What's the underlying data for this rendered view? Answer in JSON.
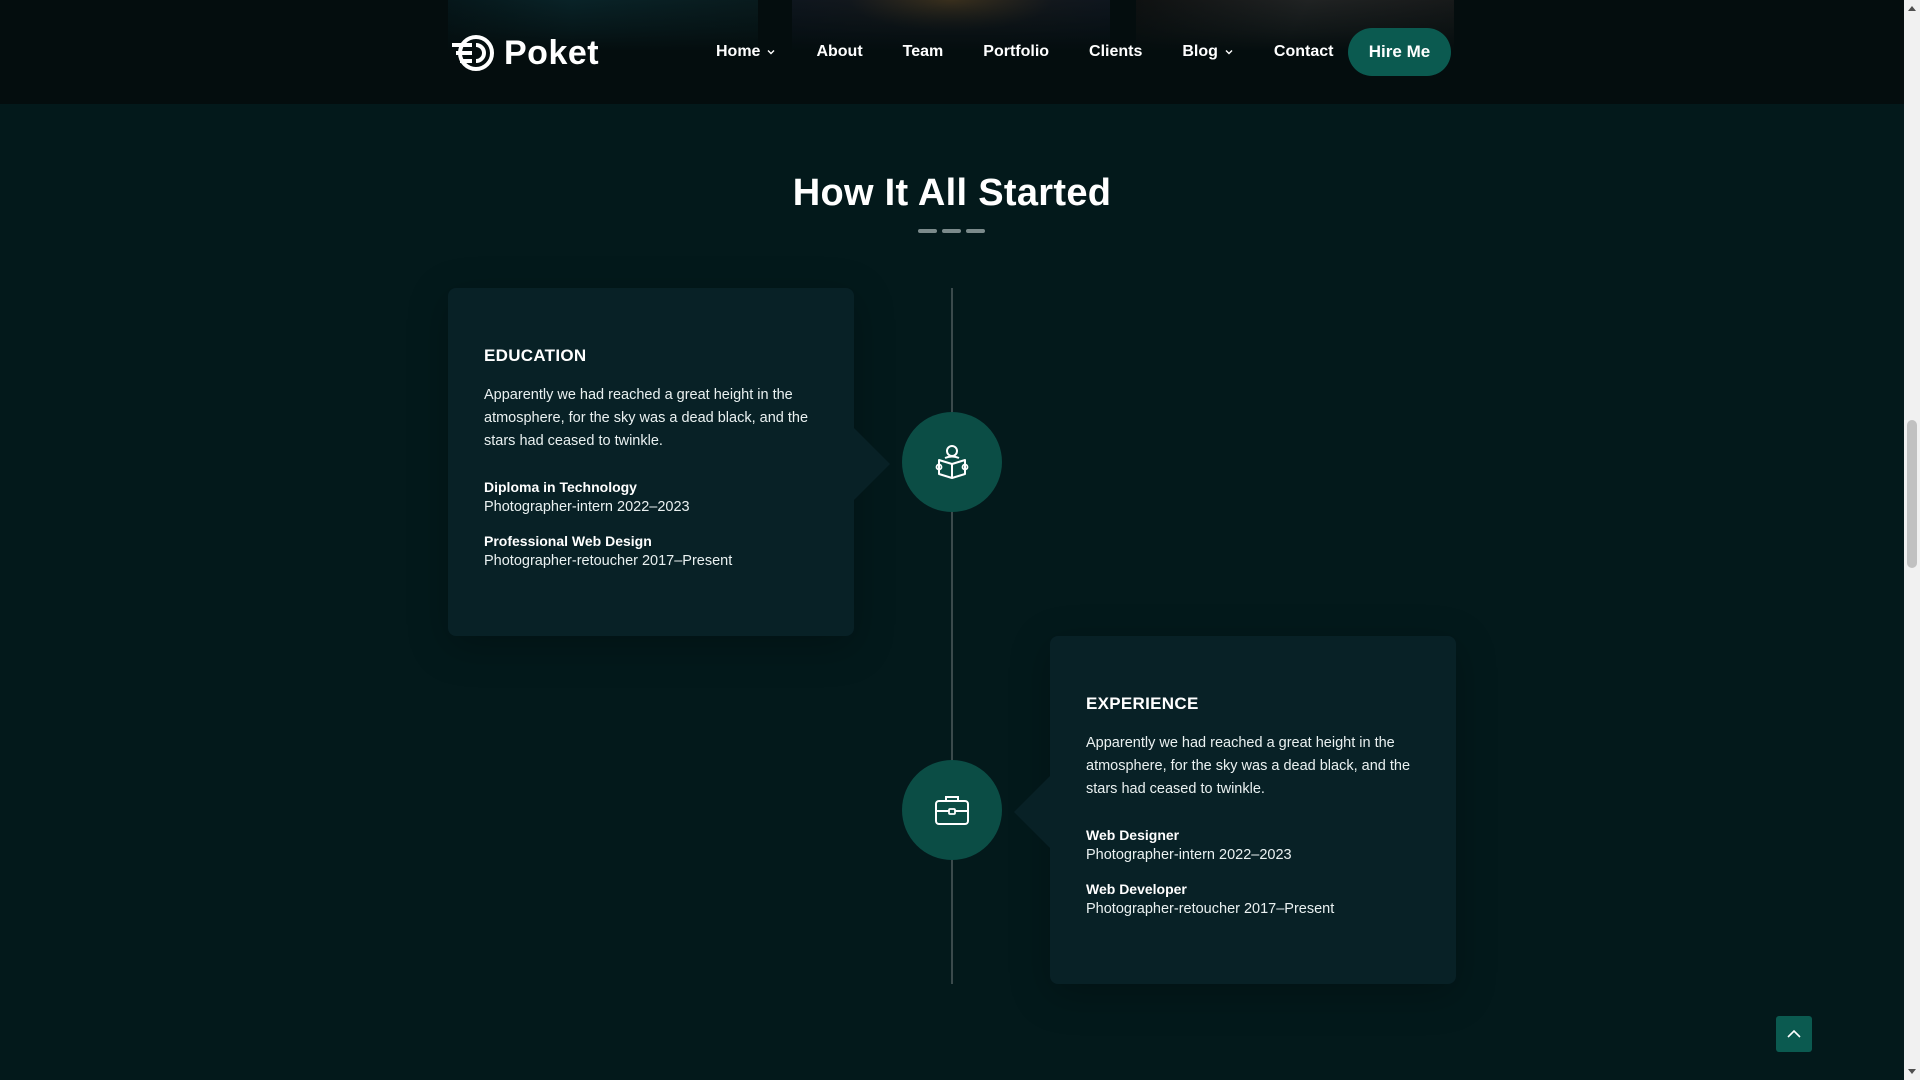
{
  "brand": {
    "name": "Poket",
    "accent": "#0b5a50"
  },
  "nav": {
    "items": [
      {
        "label": "Home",
        "dropdown": true
      },
      {
        "label": "About",
        "dropdown": false
      },
      {
        "label": "Team",
        "dropdown": false
      },
      {
        "label": "Portfolio",
        "dropdown": false
      },
      {
        "label": "Clients",
        "dropdown": false
      },
      {
        "label": "Blog",
        "dropdown": true
      },
      {
        "label": "Contact",
        "dropdown": false
      }
    ],
    "cta_label": "Hire Me"
  },
  "section": {
    "title": "How It All Started"
  },
  "timeline": {
    "education": {
      "title": "EDUCATION",
      "icon": "reading-person-icon",
      "description": "Apparently we had reached a great height in the atmosphere, for the sky was a dead black, and the stars had ceased to twinkle.",
      "entries": [
        {
          "title": "Diploma in Technology",
          "subtitle": "Photographer-intern 2022–2023"
        },
        {
          "title": "Professional Web Design",
          "subtitle": "Photographer-retoucher 2017–Present"
        }
      ]
    },
    "experience": {
      "title": "EXPERIENCE",
      "icon": "briefcase-icon",
      "description": "Apparently we had reached a great height in the atmosphere, for the sky was a dead black, and the stars had ceased to twinkle.",
      "entries": [
        {
          "title": "Web Designer",
          "subtitle": "Photographer-intern 2022–2023"
        },
        {
          "title": "Web Developer",
          "subtitle": "Photographer-retoucher 2017–Present"
        }
      ]
    }
  },
  "scroll_top": {
    "icon": "chevron-up-icon"
  }
}
